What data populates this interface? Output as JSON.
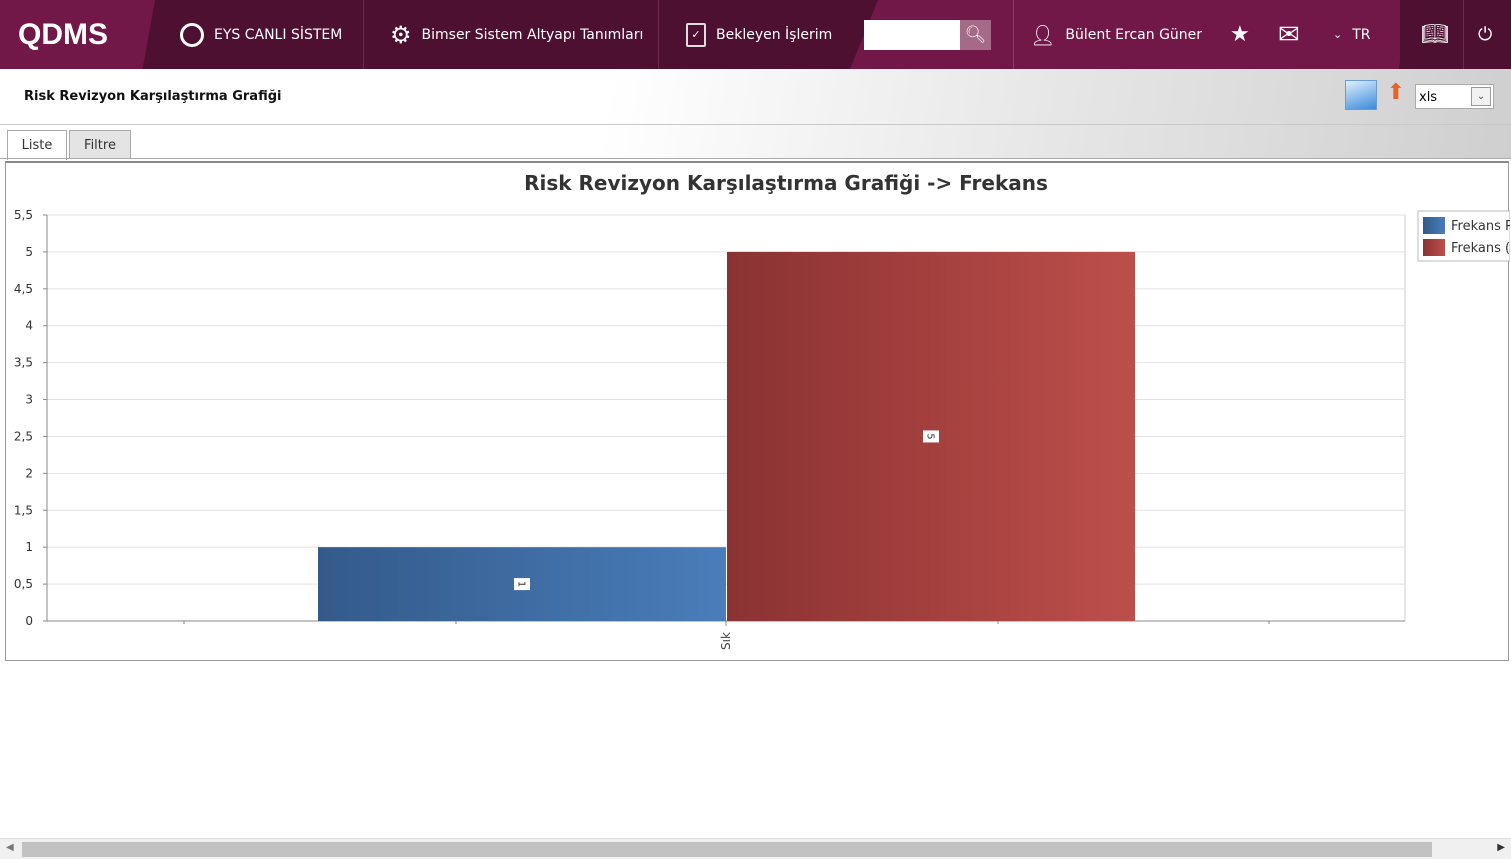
{
  "header": {
    "logo": "QDMS",
    "nav": [
      {
        "label": "EYS CANLI SİSTEM",
        "icon": "q-icon"
      },
      {
        "label": "Bimser Sistem Altyapı Tanımları",
        "icon": "gear-icon"
      },
      {
        "label": "Bekleyen İşlerim",
        "icon": "clipboard-icon"
      }
    ],
    "search_value": "",
    "user": "Bülent Ercan Güner",
    "language": "TR"
  },
  "page": {
    "title": "Risk Revizyon Karşılaştırma Grafiği",
    "export_format": "xls",
    "tabs": [
      {
        "label": "Liste",
        "active": true
      },
      {
        "label": "Filtre",
        "active": false
      }
    ]
  },
  "chart_data": {
    "type": "bar",
    "title": "Risk Revizyon Karşılaştırma Grafiği -> Frekans",
    "categories": [
      "Sık"
    ],
    "series": [
      {
        "name": "Frekans P",
        "color": "#4a7dba",
        "values": [
          1
        ]
      },
      {
        "name": "Frekans (",
        "color": "#b84c48",
        "values": [
          5
        ]
      }
    ],
    "ylim": [
      0,
      5.5
    ],
    "yticks": [
      "0",
      "0,5",
      "1",
      "1,5",
      "2",
      "2,5",
      "3",
      "3,5",
      "4",
      "4,5",
      "5",
      "5,5"
    ],
    "legend": "right",
    "grid": true
  }
}
